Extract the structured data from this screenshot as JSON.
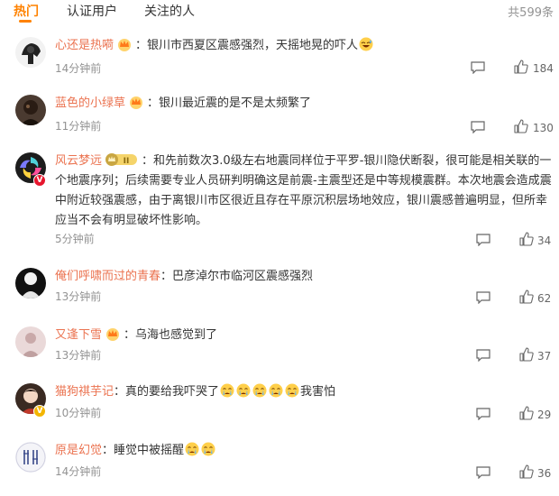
{
  "tabs": [
    {
      "label": "热门",
      "active": true
    },
    {
      "label": "认证用户",
      "active": false
    },
    {
      "label": "关注的人",
      "active": false
    }
  ],
  "total_label": "共599条",
  "colors": {
    "accent": "#ff8200",
    "username": "#eb7350",
    "meta": "#939393",
    "text": "#333333"
  },
  "comments": [
    {
      "user": "心还是热嗬",
      "medal": "crown-icon",
      "text": "：银川市西夏区震感强烈，天摇地晃的吓人",
      "emoji": [
        "sweat-laugh-emoji"
      ],
      "time": "14分钟前",
      "likes": "184"
    },
    {
      "user": "蓝色的小绿草",
      "medal": "crown-icon",
      "text": "：银川最近震的是不是太频繁了",
      "emoji": [],
      "time": "11分钟前",
      "likes": "130"
    },
    {
      "user": "风云梦远",
      "medal": "level-badge-icon",
      "medal_text": "II",
      "text": "：和先前数次3.0级左右地震同样位于平罗-银川隐伏断裂，很可能是相关联的一个地震序列；后续需要专业人员研判明确这是前震-主震型还是中等规模震群。本次地震会造成震中附近较强震感，由于离银川市区很近且存在平原沉积层场地效应，银川震感普遍明显，但所幸应当不会有明显破坏性影响。",
      "emoji": [],
      "verified": "V",
      "time": "5分钟前",
      "likes": "34"
    },
    {
      "user": "俺们呼啸而过的青春",
      "medal": "",
      "text": "：巴彦淖尔市临河区震感强烈",
      "emoji": [],
      "time": "13分钟前",
      "likes": "62"
    },
    {
      "user": "又逢下雪",
      "medal": "crown-icon",
      "text": "：乌海也感觉到了",
      "emoji": [],
      "time": "13分钟前",
      "likes": "37"
    },
    {
      "user": "猫狗祺芋记",
      "medal": "",
      "text": "：真的要给我吓哭了",
      "emoji": [
        "crying-emoji",
        "crying-emoji",
        "crying-emoji",
        "crying-emoji",
        "crying-emoji"
      ],
      "after_text": "我害怕",
      "verified": "V",
      "time": "10分钟前",
      "likes": "29"
    },
    {
      "user": "原是幻觉",
      "medal": "",
      "text": "：睡觉中被摇醒",
      "emoji": [
        "crying-emoji",
        "crying-emoji"
      ],
      "time": "14分钟前",
      "likes": "36"
    }
  ]
}
